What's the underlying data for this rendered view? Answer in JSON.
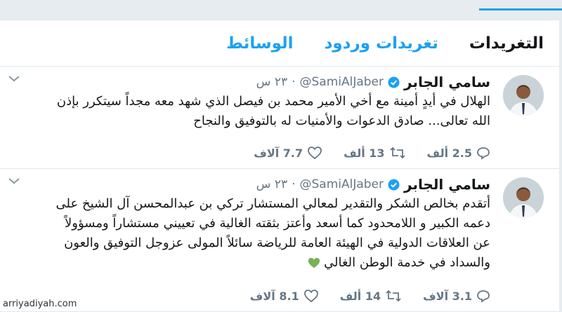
{
  "tabs": [
    {
      "label": "التغريدات",
      "active": true
    },
    {
      "label": "تغريدات وردود",
      "active": false
    },
    {
      "label": "الوسائط",
      "active": false
    }
  ],
  "tweets": [
    {
      "name": "سامي الجابر",
      "handle": "@SamiAlJaber",
      "time": "٢٣ س",
      "text_lines": [
        "الهلال في أيدٍ أمينة مع أخي الأمير محمد بن فيصل الذي شهد معه مجداً سيتكرر بإذن",
        "الله تعالى... صادق الدعوات والأمنيات له بالتوفيق والنجاح"
      ],
      "replies": "2.5 ألف",
      "retweets": "13 ألف",
      "likes": "7.7 آلاف"
    },
    {
      "name": "سامي الجابر",
      "handle": "@SamiAlJaber",
      "time": "٢٣ س",
      "text_lines": [
        "أتقدم بخالص الشكر والتقدير لمعالي المستشار تركي بن عبدالمحسن آل الشيخ على",
        "دعمه الكبير و اللامحدود كما أسعد وأعتز بثقته الغالية في تعييني مستشاراً ومسؤولاً",
        "عن العلاقات الدولية في الهيئة العامة للرياضة سائلاً المولى عزوجل التوفيق والعون",
        "والسداد في خدمة الوطن الغالي"
      ],
      "replies": "3.1 آلاف",
      "retweets": "14 ألف",
      "likes": "8.1 آلاف"
    }
  ],
  "colors": {
    "accent": "#1da1f2",
    "text": "#14171a",
    "muted": "#657786",
    "heart": "#77b255"
  },
  "icons": [
    "chevron-down-icon",
    "verified-badge-icon",
    "reply-icon",
    "retweet-icon",
    "like-icon",
    "green-heart-icon"
  ],
  "watermark": "arriyadiyah.com"
}
